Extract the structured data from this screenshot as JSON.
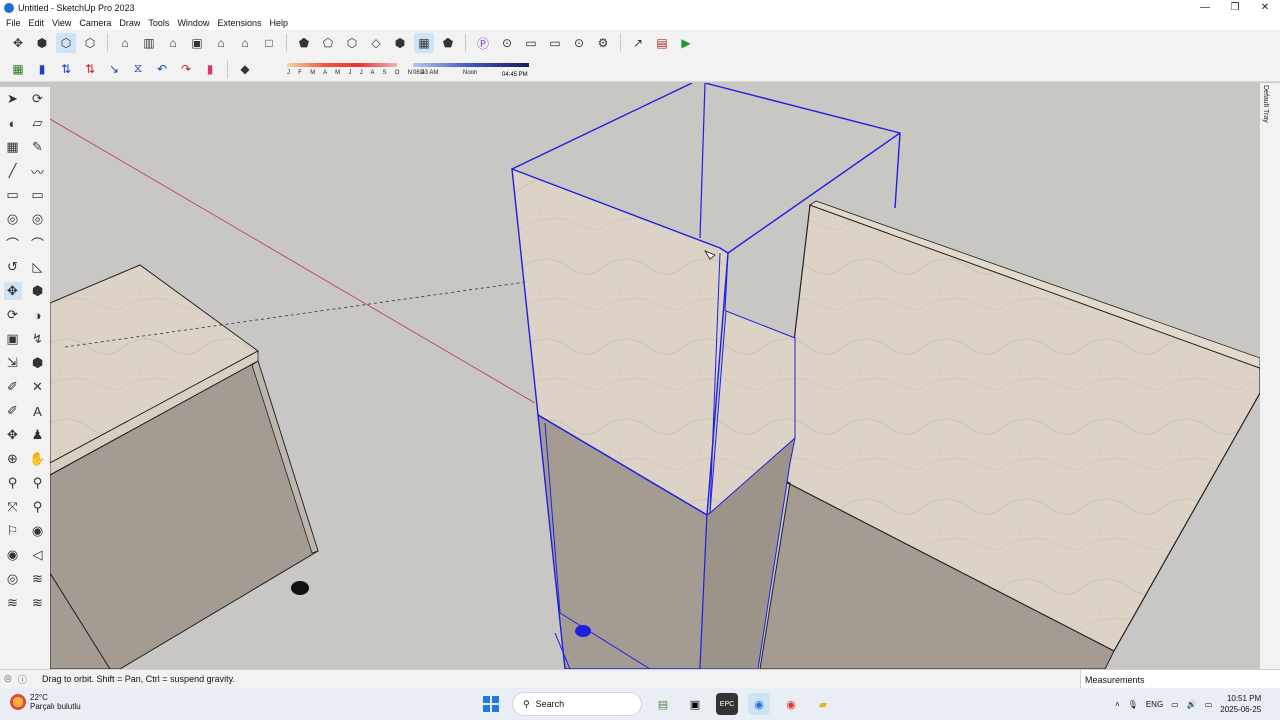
{
  "window": {
    "title": "Untitled - SketchUp Pro 2023",
    "controls": [
      "—",
      "❐",
      "✕"
    ]
  },
  "menu": [
    "File",
    "Edit",
    "View",
    "Camera",
    "Draw",
    "Tools",
    "Window",
    "Extensions",
    "Help"
  ],
  "toolbar1": [
    "✥",
    "⬢",
    "⬡",
    "⬡",
    "⌂",
    "▥",
    "⌂",
    "▣",
    "⌂",
    "⌂",
    "□",
    "⬟",
    "⬠",
    "⬡",
    "◇",
    "⬢",
    "▦",
    "⬟",
    "Ⓟ",
    "⊙",
    "▭",
    "▭",
    "⊙",
    "⚙",
    "↗",
    "▤",
    "▶"
  ],
  "toolbar2": [
    "▦",
    "▮",
    "⇅",
    "⇅",
    "↘",
    "⧖",
    "↶",
    "↷",
    "▮",
    "◆"
  ],
  "shadow": {
    "months": "J F M A M J J A S O N D",
    "time_start": "06:43 AM",
    "time_mid": "Noon",
    "time_end": "04:45 PM"
  },
  "left_tools": [
    [
      "➤",
      "⟳"
    ],
    [
      "◐",
      "▱"
    ],
    [
      "▦",
      "✎"
    ],
    [
      "╱",
      "〰"
    ],
    [
      "▭",
      "▭"
    ],
    [
      "◎",
      "◎"
    ],
    [
      "⌒",
      "⌒"
    ],
    [
      "↺",
      "◺"
    ],
    [
      "✥",
      "⬢"
    ],
    [
      "⟳",
      "◑"
    ],
    [
      "▣",
      "↯"
    ],
    [
      "⇲",
      "⬢"
    ],
    [
      "✐",
      "✕"
    ],
    [
      "✐",
      "A"
    ],
    [
      "✥",
      "♟"
    ],
    [
      "⊕",
      "✋"
    ],
    [
      "⚲",
      "⚲"
    ],
    [
      "⤧",
      "⚲"
    ],
    [
      "⚐",
      "◉"
    ],
    [
      "◉",
      "◁"
    ],
    [
      "◎",
      "≋"
    ],
    [
      "≋",
      "≋"
    ]
  ],
  "right_tray_label": "Default Tray",
  "status": {
    "hint": "Drag to orbit. Shift = Pan, Ctrl = suspend gravity.",
    "measurements_label": "Measurements"
  },
  "taskbar": {
    "temp": "22°C",
    "weather": "Parçalı bulutlu",
    "search_placeholder": "Search",
    "lang": "ENG",
    "time": "10:51 PM",
    "date": "2025-06-25",
    "apps": [
      "▤",
      "▣",
      "EPC",
      "◉",
      "◉",
      "▰"
    ]
  },
  "colors": {
    "selection": "#1f1fe0",
    "axis_red": "#b4383a",
    "marble": "#dcd3c6",
    "cabinet_body": "#a49c93",
    "background": "#c8c7c3"
  }
}
